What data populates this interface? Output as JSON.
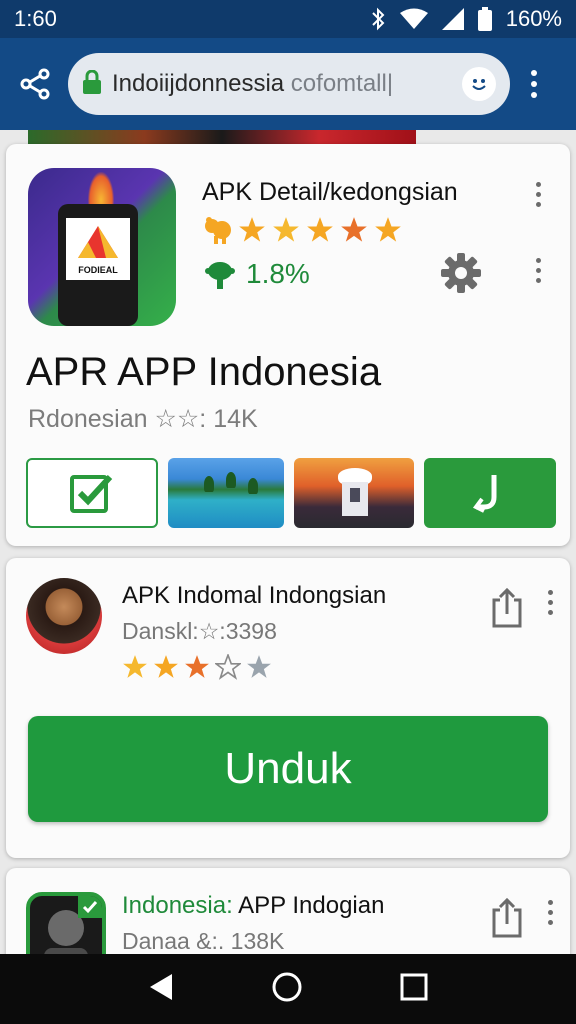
{
  "status_bar": {
    "time": "1:60",
    "battery": "160%",
    "icons": [
      "bluetooth-icon",
      "wifi-icon",
      "signal-icon",
      "battery-icon"
    ]
  },
  "toolbar": {
    "url_main": "Indoiijdonnessia",
    "url_dim": "cofomtall|",
    "icons": [
      "share-icon",
      "lock-icon",
      "smiley-icon",
      "overflow-menu-icon"
    ]
  },
  "app_card": {
    "icon_brand": "FODIEAL",
    "detail_title": "APK Detail/kedongsian",
    "rating_stars": 5,
    "percent": "1.8%",
    "app_name": "APR APP Indonesia",
    "meta": "Rdonesian ☆☆: 14K",
    "tiles": [
      "check-icon",
      "beach-image",
      "gazebo-image",
      "download-icon"
    ]
  },
  "second_card": {
    "title": "APK Indomal Indongsian",
    "subtitle": "Danskl:☆:3398",
    "rating": 2.5,
    "button_label": "Unduk"
  },
  "third_card": {
    "title_green": "Indonesia:",
    "title_rest": " APP Indogian",
    "subtitle": "Danaa &:. 138K"
  },
  "nav": [
    "back-icon",
    "home-icon",
    "recents-icon"
  ],
  "colors": {
    "status_bar": "#0f3a6b",
    "toolbar": "#134a86",
    "accent_green": "#1f9a3e",
    "star": "#f5a623"
  }
}
